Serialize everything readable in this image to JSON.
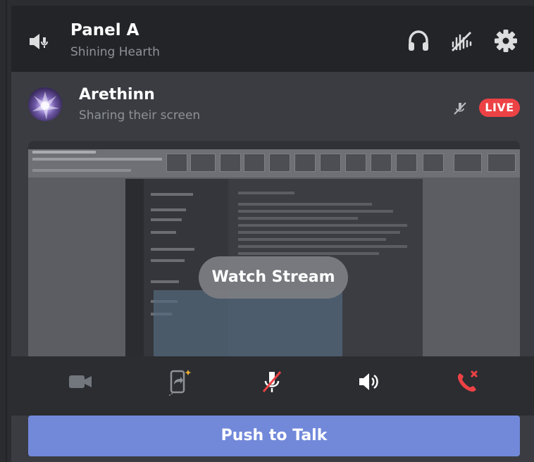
{
  "header": {
    "title": "Panel A",
    "subtitle": "Shining Hearth",
    "icons": [
      "speaker-sign-icon",
      "headphones-icon",
      "noise-suppression-icon",
      "gear-icon"
    ]
  },
  "participant": {
    "name": "Arethinn",
    "status": "Sharing their screen",
    "live_label": "LIVE",
    "icons": [
      "mic-muted-icon"
    ]
  },
  "stream": {
    "watch_label": "Watch Stream"
  },
  "controls": {
    "icons": [
      "video-camera-icon",
      "screen-share-icon",
      "microphone-muted-icon",
      "speaker-volume-icon",
      "hang-up-icon"
    ]
  },
  "push_to_talk": {
    "label": "Push to Talk"
  },
  "colors": {
    "background": "#2b2d31",
    "panel": "#3a3c42",
    "header": "#232428",
    "live_red": "#ed4245",
    "blurple": "#7289da",
    "muted_text": "#8e9297"
  }
}
